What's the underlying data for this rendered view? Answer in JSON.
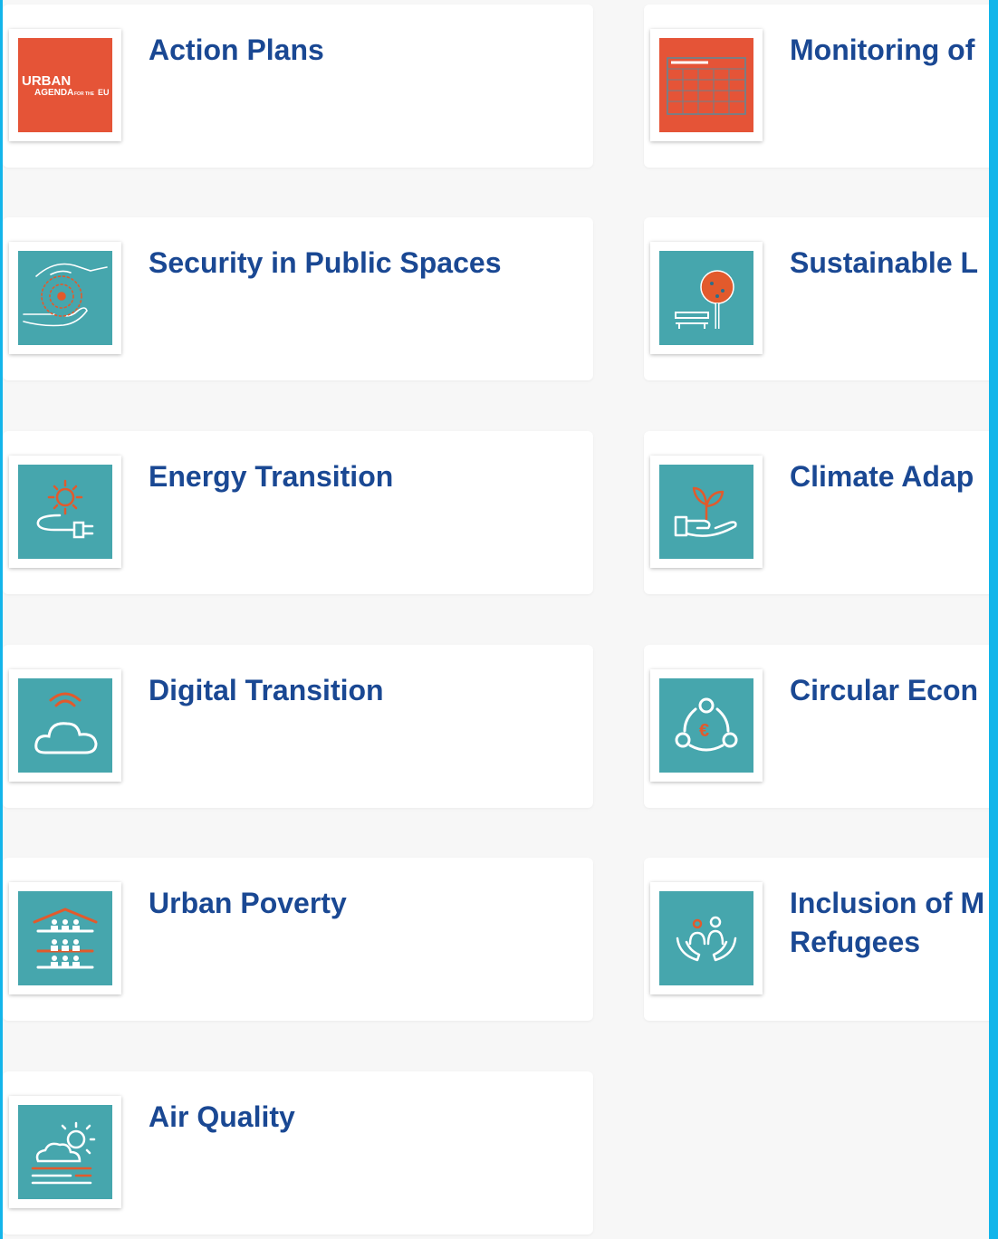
{
  "colors": {
    "accent_edge": "#13b5ea",
    "title": "#1a4893",
    "teal_tile": "#46a6ad",
    "orange_tile": "#e55437",
    "orange_stroke": "#e25a2c"
  },
  "cards": [
    {
      "id": "action-plans",
      "title": "Action Plans",
      "icon": "urban-agenda-logo-icon",
      "tile": "#e55437",
      "logo": {
        "line1": "URBAN",
        "line2": "AGENDA",
        "line3": "FOR THE",
        "line4": "EU"
      }
    },
    {
      "id": "monitoring",
      "title": "Monitoring of",
      "icon": "calendar-grid-icon",
      "tile": "#e55437"
    },
    {
      "id": "security-public-spaces",
      "title": "Security in Public Spaces",
      "icon": "protecting-hands-icon",
      "tile": "#46a6ad"
    },
    {
      "id": "sustainable-land-use",
      "title": "Sustainable L",
      "icon": "tree-bench-icon",
      "tile": "#46a6ad"
    },
    {
      "id": "energy-transition",
      "title": "Energy Transition",
      "icon": "sun-plug-icon",
      "tile": "#46a6ad"
    },
    {
      "id": "climate-adaptation",
      "title": "Climate Adap",
      "icon": "plant-hand-icon",
      "tile": "#46a6ad"
    },
    {
      "id": "digital-transition",
      "title": "Digital Transition",
      "icon": "cloud-signal-icon",
      "tile": "#46a6ad"
    },
    {
      "id": "circular-economy",
      "title": "Circular Econ",
      "icon": "euro-cycle-icon",
      "tile": "#46a6ad"
    },
    {
      "id": "urban-poverty",
      "title": "Urban Poverty",
      "icon": "housing-people-icon",
      "tile": "#46a6ad"
    },
    {
      "id": "inclusion-migrants",
      "title": "Inclusion of M\nRefugees",
      "icon": "people-hands-icon",
      "tile": "#46a6ad"
    },
    {
      "id": "air-quality",
      "title": "Air Quality",
      "icon": "cloud-sun-smog-icon",
      "tile": "#46a6ad"
    }
  ]
}
